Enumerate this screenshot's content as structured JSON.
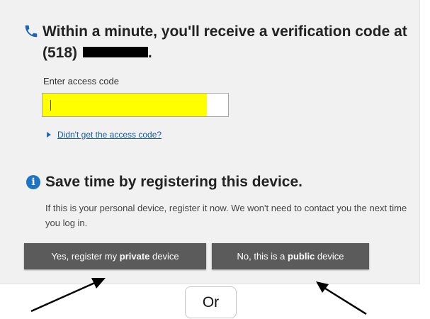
{
  "verify": {
    "headline_line1": "Within a minute, you'll receive a verification code at",
    "phone_prefix": "(518) ",
    "phone_suffix": "."
  },
  "access_code": {
    "label": "Enter access code",
    "value": ""
  },
  "help": {
    "link_label": "Didn't get the access code?"
  },
  "register": {
    "heading": "Save time by registering this device.",
    "body": "If this is your personal device, register it now. We won't need to contact you the next time you log in."
  },
  "buttons": {
    "private": {
      "prefix": "Yes, register my ",
      "bold": "private",
      "suffix": " device"
    },
    "public": {
      "prefix": "No, this is a ",
      "bold": "public",
      "suffix": " device"
    }
  },
  "annotation": {
    "or_label": "Or"
  },
  "icons": {
    "phone": "phone-icon",
    "info": "info-icon",
    "expand": "triangle-right-icon"
  },
  "colors": {
    "panel_bg": "#f1f1f1",
    "input_highlight": "#ffff00",
    "link": "#1a5aa6",
    "info_icon": "#1d73c4",
    "button_bg": "#5b5b5b"
  }
}
